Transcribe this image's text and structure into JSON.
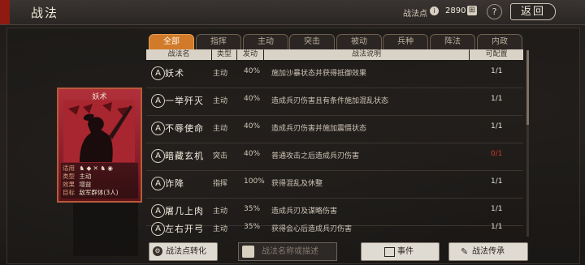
{
  "header": {
    "title": "战法",
    "points_label": "战法点",
    "points_value": "2890",
    "help": "?",
    "back": "返回"
  },
  "tabs": [
    "全部",
    "指挥",
    "主动",
    "突击",
    "被动",
    "兵种",
    "阵法",
    "内政"
  ],
  "columns": [
    "战法名",
    "类型",
    "发动",
    "战法说明",
    "可配置"
  ],
  "rows": [
    {
      "badge": "A",
      "name": "妖术",
      "type": "主动",
      "pct": "40%",
      "desc": "施加沙暴状态并获得抵御效果",
      "cfg": "1/1",
      "warn": false
    },
    {
      "badge": "A",
      "name": "一举歼灭",
      "type": "主动",
      "pct": "40%",
      "desc": "造成兵刃伤害且有条件施加混乱状态",
      "cfg": "1/1",
      "warn": false
    },
    {
      "badge": "A",
      "name": "不辱使命",
      "type": "主动",
      "pct": "40%",
      "desc": "造成兵刃伤害并施加震慑状态",
      "cfg": "1/1",
      "warn": false
    },
    {
      "badge": "A",
      "name": "暗藏玄机",
      "type": "突击",
      "pct": "40%",
      "desc": "普通攻击之后造成兵刃伤害",
      "cfg": "0/1",
      "warn": true
    },
    {
      "badge": "A",
      "name": "诈降",
      "type": "指挥",
      "pct": "100%",
      "desc": "获得混乱及休整",
      "cfg": "1/1",
      "warn": false
    },
    {
      "badge": "A",
      "name": "屠几上肉",
      "type": "主动",
      "pct": "35%",
      "desc": "造成兵刃及谋略伤害",
      "cfg": "1/1",
      "warn": false
    },
    {
      "badge": "A",
      "name": "左右开弓",
      "type": "主动",
      "pct": "35%",
      "desc": "获得会心后造成兵刃伤害",
      "cfg": "1/1",
      "warn": false
    }
  ],
  "card": {
    "title": "妖术",
    "lines": [
      {
        "label": "适用",
        "value": ""
      },
      {
        "label": "类型",
        "value": "主动"
      },
      {
        "label": "效果",
        "value": "增益"
      },
      {
        "label": "目标",
        "value": "敌军群体(3人)"
      }
    ]
  },
  "buttons": {
    "convert": "战法点转化",
    "search_placeholder": "战法名称或描述",
    "event": "事件",
    "inherit": "战法传承"
  }
}
